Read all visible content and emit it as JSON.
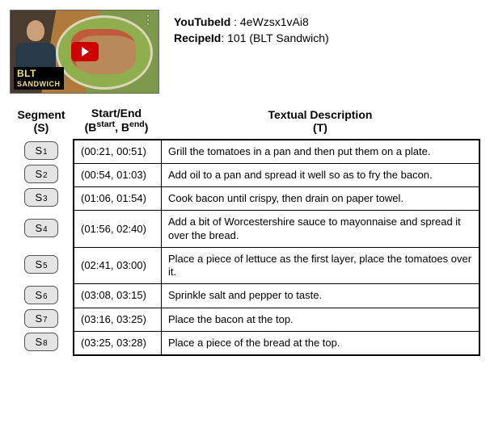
{
  "meta": {
    "youtube_label": "YouTubeId",
    "youtube_id": "4eWzsx1vAi8",
    "recipe_label": "RecipeId",
    "recipe_id": "101",
    "recipe_name": "(BLT Sandwich)"
  },
  "thumb": {
    "title_text": "BLT",
    "subtitle_text": "SANDWICH"
  },
  "headers": {
    "seg_top": "Segment",
    "seg_sub": "(S)",
    "be_top": "Start/End",
    "be_sub_prefix": "(B",
    "be_sub_start": "start",
    "be_sub_mid": ", B",
    "be_sub_end": "end",
    "be_sub_suffix": ")",
    "t_top": "Textual Description",
    "t_sub": "(T)"
  },
  "rows": [
    {
      "seg": "S",
      "idx": "1",
      "be": "(00:21, 00:51)",
      "desc": "Grill the tomatoes in a pan and then put them on a plate."
    },
    {
      "seg": "S",
      "idx": "2",
      "be": "(00:54, 01:03)",
      "desc": "Add oil to a pan and spread it well so as to fry the bacon."
    },
    {
      "seg": "S",
      "idx": "3",
      "be": "(01:06, 01:54)",
      "desc": "Cook bacon until crispy, then drain on paper towel."
    },
    {
      "seg": "S",
      "idx": "4",
      "be": "(01:56, 02:40)",
      "desc": "Add a bit of Worcestershire sauce to mayonnaise and spread it over the bread."
    },
    {
      "seg": "S",
      "idx": "5",
      "be": "(02:41, 03:00)",
      "desc": "Place a piece of lettuce as the first layer, place the tomatoes over it."
    },
    {
      "seg": "S",
      "idx": "6",
      "be": "(03:08, 03:15)",
      "desc": "Sprinkle salt and pepper to taste."
    },
    {
      "seg": "S",
      "idx": "7",
      "be": "(03:16, 03:25)",
      "desc": "Place the bacon at the top."
    },
    {
      "seg": "S",
      "idx": "8",
      "be": "(03:25, 03:28)",
      "desc": "Place a piece of the bread at the top."
    }
  ]
}
